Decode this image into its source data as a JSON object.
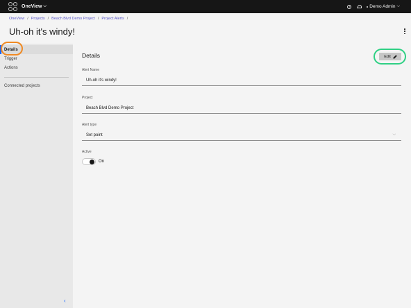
{
  "topbar": {
    "app_name": "OneView",
    "app_chevron": "⌵",
    "help_glyph": "?",
    "user_name": "Demo Admin",
    "user_chevron": "⌵"
  },
  "breadcrumb": {
    "items": [
      "OneView",
      "Projects",
      "Beach Blvd Demo Project",
      "Project Alerts"
    ],
    "separator": "/"
  },
  "page": {
    "title": "Uh-oh it's windy!"
  },
  "sidenav": {
    "items": [
      "Details",
      "Trigger",
      "Actions"
    ],
    "active": "Details",
    "secondary": "Connected projects",
    "collapse_glyph": "‹"
  },
  "main": {
    "title": "Details",
    "edit_label": "Edit",
    "fields": {
      "alert_name": {
        "label": "Alert Name",
        "value": "Uh-oh it's windy!"
      },
      "project": {
        "label": "Project",
        "value": "Beach Blvd Demo Project"
      },
      "alert_type": {
        "label": "Alert type",
        "value": "Set point",
        "chevron": "⌵"
      }
    },
    "active": {
      "label": "Active",
      "state_text": "On",
      "on": true
    }
  },
  "colors": {
    "topbar_bg": "#161616",
    "breadcrumb_link": "#5a57c9",
    "highlight_orange": "#f08a24",
    "highlight_green": "#2fd084",
    "edit_button_bg": "#c6c6c6"
  }
}
